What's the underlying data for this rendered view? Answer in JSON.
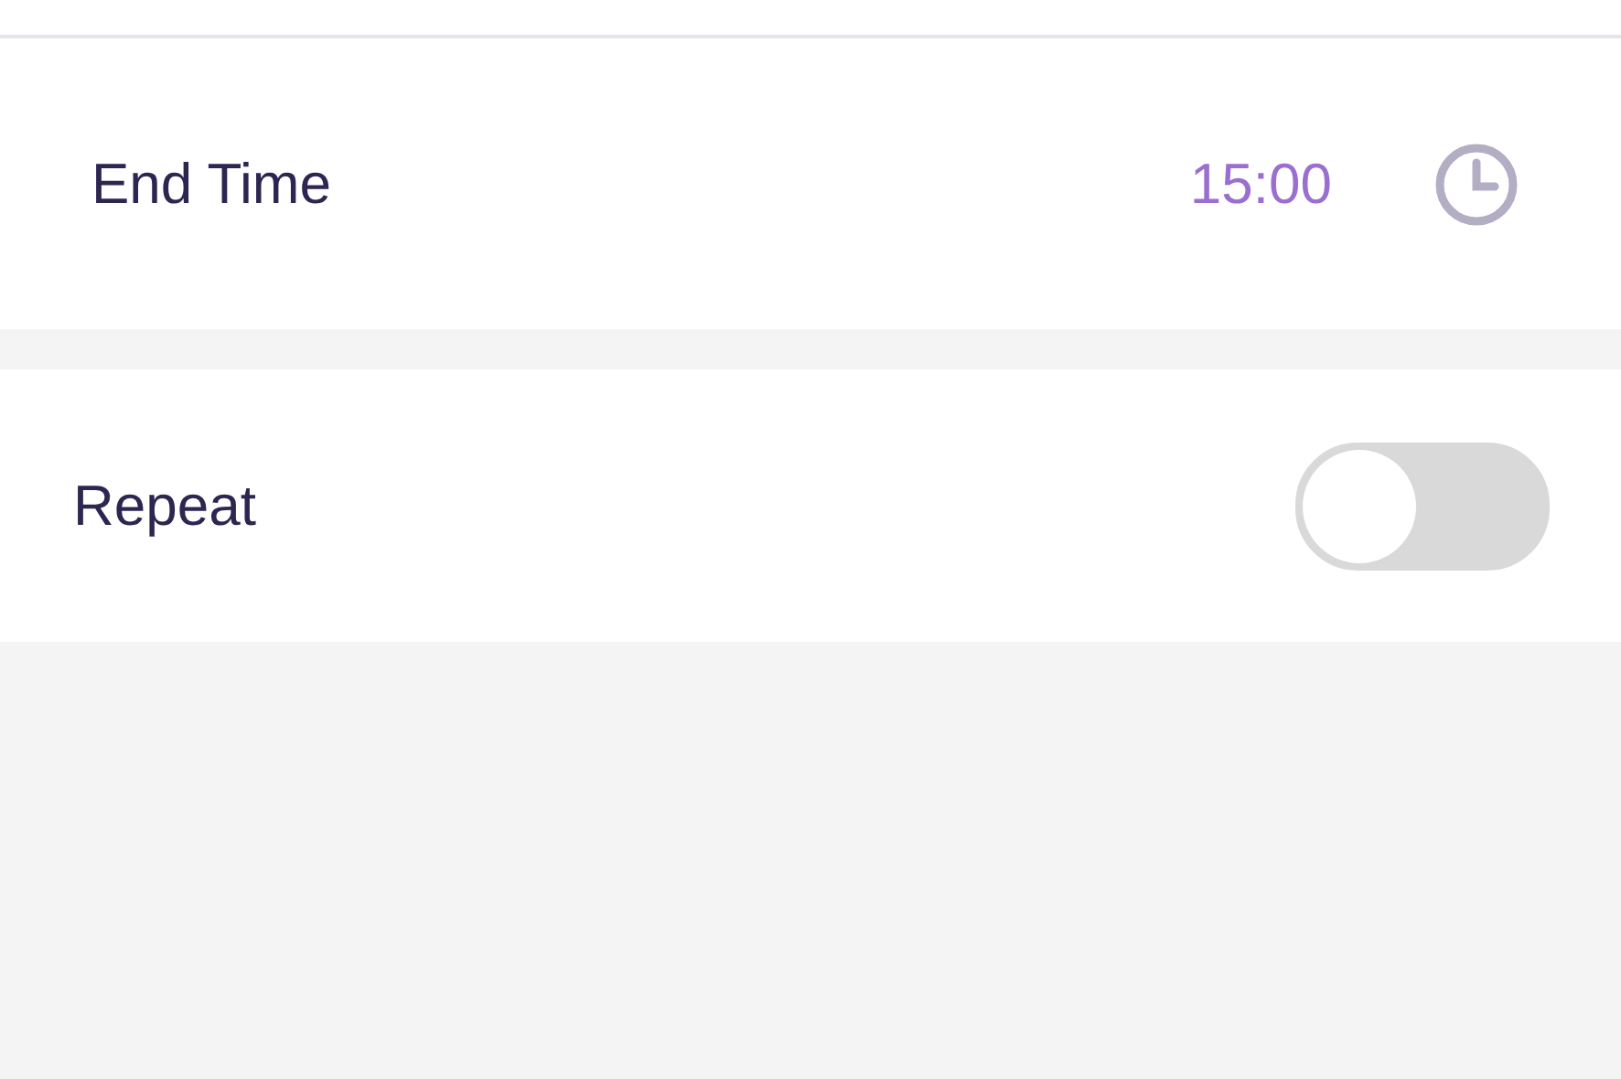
{
  "end_time": {
    "label": "End Time",
    "value": "15:00"
  },
  "repeat": {
    "label": "Repeat",
    "on": false
  }
}
